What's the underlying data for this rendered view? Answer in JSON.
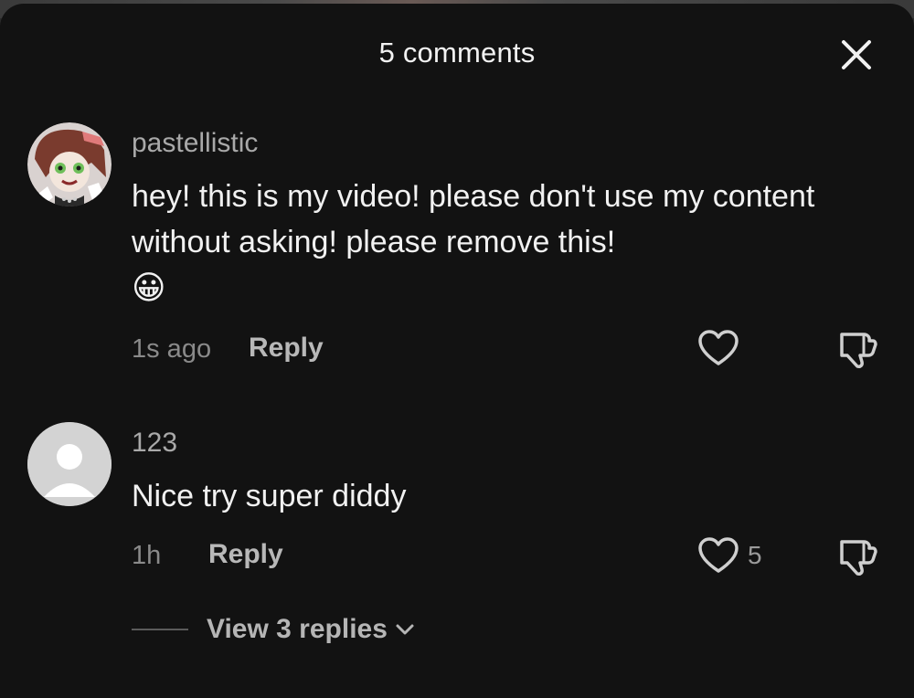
{
  "header": {
    "title": "5 comments",
    "close_icon": "close-icon"
  },
  "comments": [
    {
      "username": "pastellistic",
      "text": "hey! this is my video! please don't use my content without asking! please remove this!",
      "emoji": "😀",
      "time": "1s ago",
      "reply_label": "Reply",
      "like_count": "",
      "avatar": "illustrated-character-avatar"
    },
    {
      "username": "123",
      "text": "Nice try super diddy",
      "time": "1h",
      "reply_label": "Reply",
      "like_count": "5",
      "avatar": "default-user-avatar"
    }
  ],
  "view_replies": {
    "label": "View 3 replies"
  },
  "colors": {
    "background": "#121212",
    "text": "#f1f1f1",
    "muted": "#8a8a8a"
  }
}
